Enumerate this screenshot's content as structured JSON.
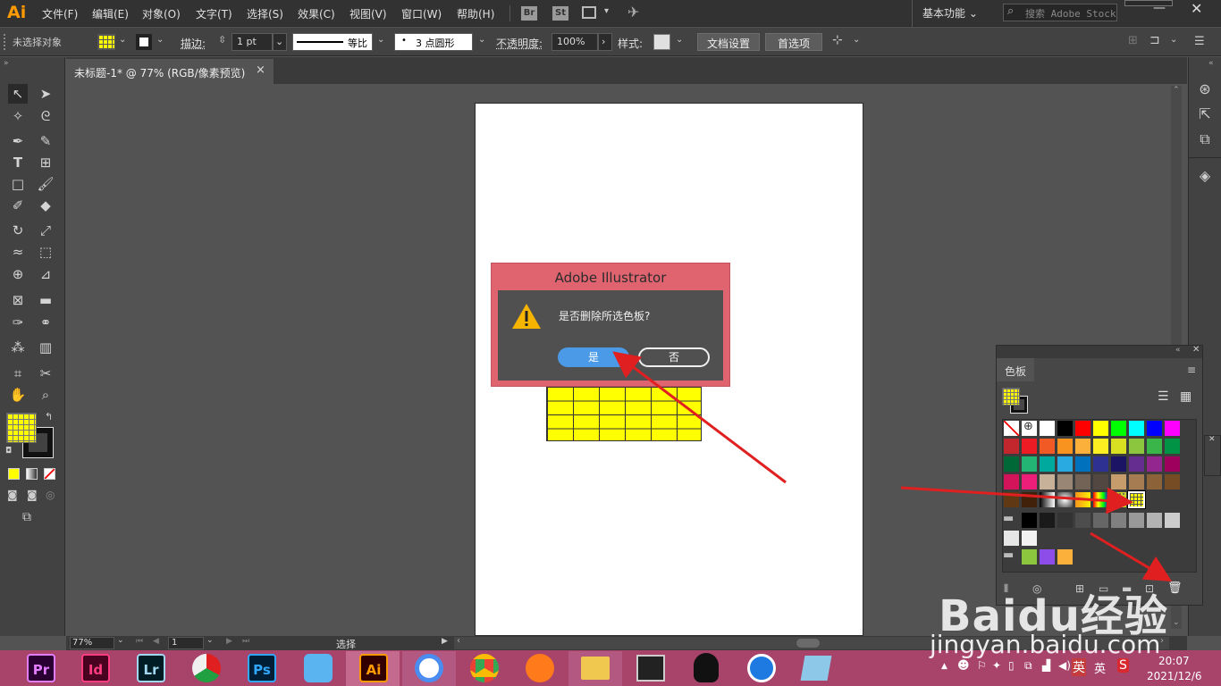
{
  "app": {
    "logo": "Ai"
  },
  "menu": [
    "文件(F)",
    "编辑(E)",
    "对象(O)",
    "文字(T)",
    "选择(S)",
    "效果(C)",
    "视图(V)",
    "窗口(W)",
    "帮助(H)"
  ],
  "menu_buttons": [
    "Br",
    "St"
  ],
  "workspace": "基本功能",
  "stock_search": {
    "placeholder": "搜索 Adobe Stock"
  },
  "control_bar": {
    "selection_label": "未选择对象",
    "stroke_label": "描边:",
    "stroke_value": "1 pt",
    "stroke_profile": "等比",
    "brush_value": "3 点圆形",
    "opacity_label": "不透明度:",
    "opacity_value": "100%",
    "style_label": "样式:",
    "doc_setup_button": "文档设置",
    "preferences_button": "首选项"
  },
  "document_tab": {
    "title": "未标题-1* @ 77% (RGB/像素预览)",
    "close": "×"
  },
  "dialog": {
    "title": "Adobe Illustrator",
    "message": "是否删除所选色板?",
    "yes_button": "是",
    "no_button": "否"
  },
  "swatches_panel": {
    "tab": "色板"
  },
  "status_bar": {
    "zoom": "77%",
    "page": "1",
    "tool": "选择"
  },
  "taskbar": {
    "apps": [
      "Pr",
      "Id",
      "Lr",
      "Ps",
      "Ai"
    ],
    "tray_input": "英",
    "tray_lang": "英",
    "time": "20:07",
    "date": "2021/12/6"
  },
  "watermark": {
    "brand": "Baidu经验",
    "url": "jingyan.baidu.com"
  },
  "colors": {
    "accent_blue": "#4a9ae8",
    "dialog_frame": "#e06470",
    "fill_yellow": "#ffff00",
    "taskbar": "#a8436a",
    "annotation_arrow": "#e02020"
  }
}
